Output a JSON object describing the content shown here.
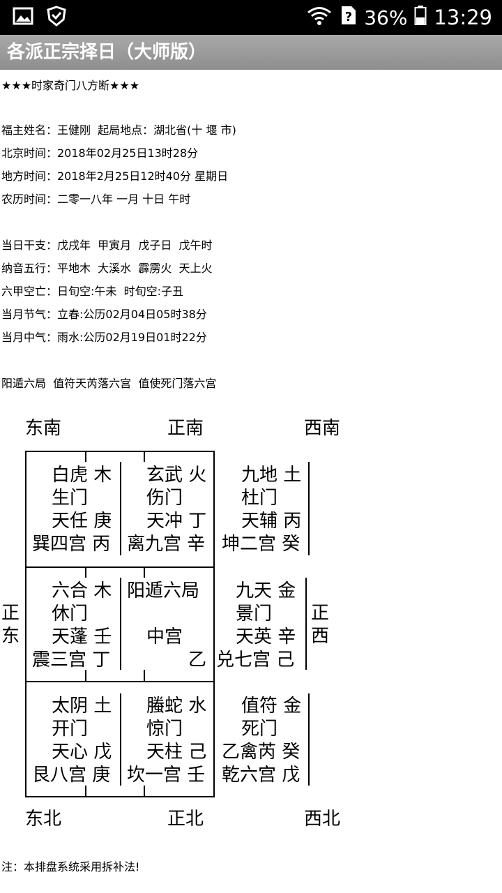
{
  "status_bar": {
    "battery": "36%",
    "time": "13:29"
  },
  "app": {
    "title": "各派正宗择日（大师版）"
  },
  "chart_title": "★★★时家奇门八方断★★★",
  "info": {
    "fuzhu": "福主姓名：王健刚  起局地点：湖北省(十 堰 市)",
    "beijing": "北京时间：2018年02月25日13时28分",
    "difang": "地方时间：2018年2月25日12时40分 星期日",
    "nongli": "农历时间：二零一八年 一月 十日 午时",
    "ganzhi": "当日干支：戊戌年  甲寅月  戊子日  戊午时",
    "nayin": "纳音五行：平地木  大溪水  霹雳火  天上火",
    "kongwang": "六甲空亡：日旬空:午未  时旬空:子丑",
    "jieqi": "当月节气：立春:公历02月04日05时38分",
    "zhongqi": "当月中气：雨水:公历02月19日01时22分",
    "ju": "阳遁六局  值符天芮落六宫  值使死门落六宫"
  },
  "directions": {
    "se": "东南",
    "s": "正南",
    "sw": "西南",
    "e1": "正",
    "e2": "东",
    "w1": "正",
    "w2": "西",
    "ne": "东北",
    "n": "正北",
    "nw": "西北"
  },
  "palaces": {
    "xun": [
      "白虎 木",
      "生门",
      "天任 庚",
      "巽四宫 丙"
    ],
    "li": [
      "玄武 火",
      "伤门",
      "天冲 丁",
      "离九宫 辛"
    ],
    "kun": [
      "九地 土",
      "杜门",
      "天辅 丙",
      "坤二宫 癸"
    ],
    "zhen": [
      "六合 木",
      "休门",
      "天蓬 壬",
      "震三宫 丁"
    ],
    "zhong": [
      "阳遁六局",
      "",
      "中宫",
      "乙"
    ],
    "dui": [
      "九天 金",
      "景门",
      "天英 辛",
      "兑七宫 己"
    ],
    "gen": [
      "太阴 土",
      "开门",
      "天心 戊",
      "艮八宫 庚"
    ],
    "kan": [
      "螣蛇 水",
      "惊门",
      "天柱 己",
      "坎一宫 壬"
    ],
    "qian": [
      "值符 金",
      "死门",
      "乙禽芮 癸",
      "乾六宫 戊"
    ]
  },
  "note": "注：本排盘系统采用拆补法!"
}
